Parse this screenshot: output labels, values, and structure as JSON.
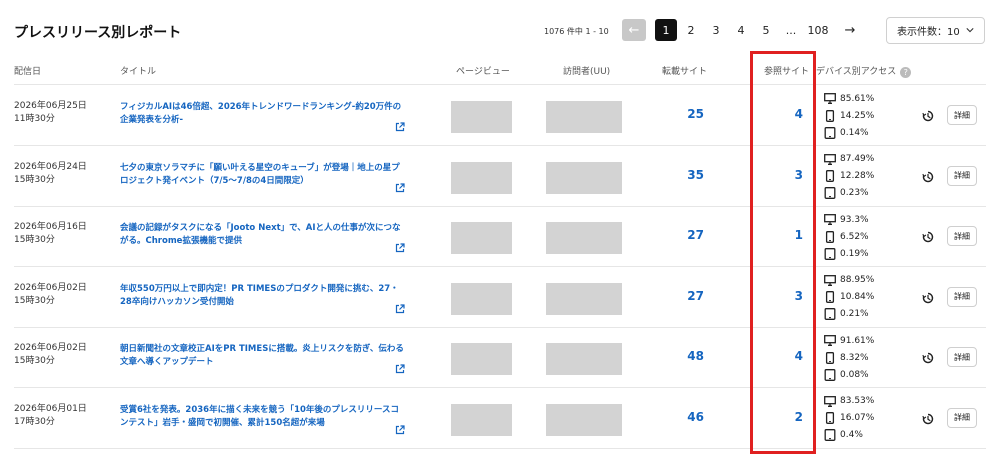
{
  "header": {
    "title": "プレスリリース別レポート",
    "range_text": "1076 件中 1 - 10",
    "per_page_label": "表示件数：10"
  },
  "pagination": {
    "prev_label": "←",
    "pages": [
      "1",
      "2",
      "3",
      "4",
      "5"
    ],
    "ellipsis": "...",
    "last": "108",
    "next_label": "→"
  },
  "columns": {
    "date": "配信日",
    "title": "タイトル",
    "pageviews": "ページビュー",
    "visitors": "訪問者(UU)",
    "republished": "転載サイト",
    "referral": "参照サイト",
    "device": "デバイス別アクセス",
    "device_help": "?"
  },
  "row_action_label": "詳細",
  "rows": [
    {
      "date": "2026年06月25日",
      "time": "11時30分",
      "title": "フィジカルAIは46倍超、2026年トレンドワードランキング-約20万件の企業発表を分析-",
      "republished": "25",
      "referral": "4",
      "desktop": "85.61%",
      "mobile": "14.25%",
      "tablet": "0.14%"
    },
    {
      "date": "2026年06月24日",
      "time": "15時30分",
      "title": "七夕の東京ソラマチに「願い叶える星空のキューブ」が登場｜地上の星プロジェクト発イベント（7/5〜7/8の4日間限定）",
      "republished": "35",
      "referral": "3",
      "desktop": "87.49%",
      "mobile": "12.28%",
      "tablet": "0.23%"
    },
    {
      "date": "2026年06月16日",
      "time": "15時30分",
      "title": "会議の記録がタスクになる「Jooto Next」で、AIと人の仕事が次につながる。Chrome拡張機能で提供",
      "republished": "27",
      "referral": "1",
      "desktop": "93.3%",
      "mobile": "6.52%",
      "tablet": "0.19%"
    },
    {
      "date": "2026年06月02日",
      "time": "15時30分",
      "title": "年収550万円以上で即内定！PR TIMESのプロダクト開発に挑む、27・28卒向けハッカソン受付開始",
      "republished": "27",
      "referral": "3",
      "desktop": "88.95%",
      "mobile": "10.84%",
      "tablet": "0.21%"
    },
    {
      "date": "2026年06月02日",
      "time": "15時30分",
      "title": "朝日新聞社の文章校正AIをPR TIMESに搭載。炎上リスクを防ぎ、伝わる文章へ導くアップデート",
      "republished": "48",
      "referral": "4",
      "desktop": "91.61%",
      "mobile": "8.32%",
      "tablet": "0.08%"
    },
    {
      "date": "2026年06月01日",
      "time": "17時30分",
      "title": "受賞6社を発表。2036年に描く未来を競う「10年後のプレスリリースコンテスト」岩手・盛岡で初開催、累計150名超が来場",
      "republished": "46",
      "referral": "2",
      "desktop": "83.53%",
      "mobile": "16.07%",
      "tablet": "0.4%"
    }
  ],
  "colors": {
    "accent": "#1565c0",
    "highlight": "#e02020"
  }
}
